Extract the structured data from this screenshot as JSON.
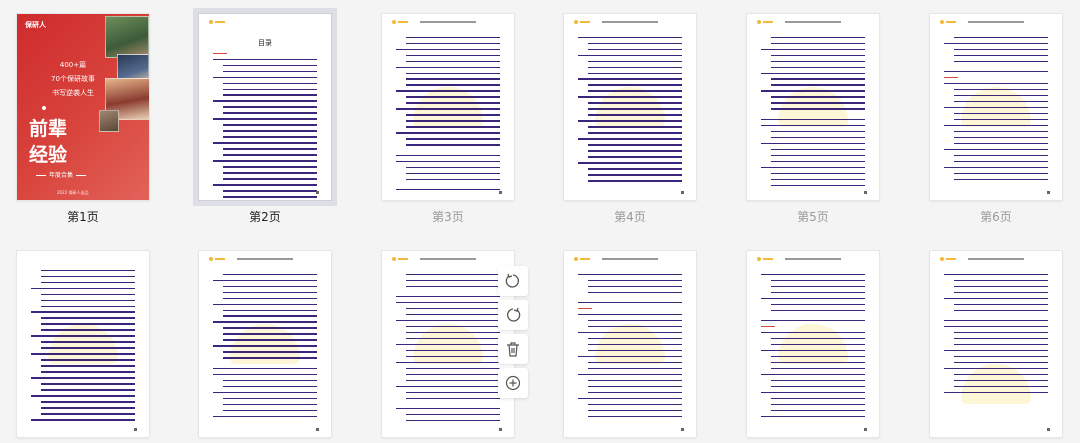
{
  "pages": [
    {
      "label": "第1页",
      "selected": false,
      "current": true
    },
    {
      "label": "第2页",
      "selected": true,
      "current": true
    },
    {
      "label": "第3页",
      "selected": false,
      "current": false
    },
    {
      "label": "第4页",
      "selected": false,
      "current": false
    },
    {
      "label": "第5页",
      "selected": false,
      "current": false
    },
    {
      "label": "第6页",
      "selected": false,
      "current": false
    }
  ],
  "cover": {
    "brand": "保研人",
    "hero_lines": [
      "400+篇",
      "70个保研故事",
      "书写逆袭人生"
    ],
    "big_lines": [
      "前辈",
      "经验"
    ],
    "subtitle": "年度合集",
    "footer": "2022  保研人出品"
  },
  "toc": {
    "title": "目录"
  },
  "tools": [
    {
      "name": "rotate-left-icon"
    },
    {
      "name": "rotate-right-icon"
    },
    {
      "name": "delete-icon"
    },
    {
      "name": "add-page-icon"
    }
  ]
}
